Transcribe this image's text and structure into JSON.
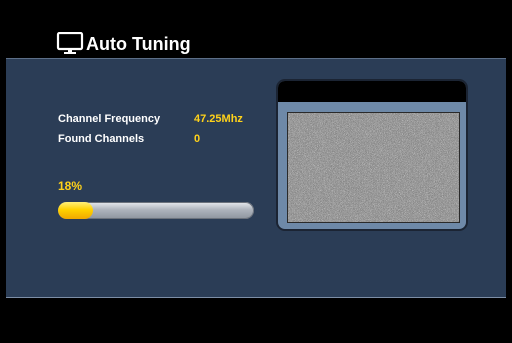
{
  "header": {
    "title": "Auto Tuning",
    "icon": "tv-icon"
  },
  "scan_info": {
    "frequency_label": "Channel Frequency",
    "frequency_value": "47.25Mhz",
    "found_label": "Found Channels",
    "found_value": "0"
  },
  "progress": {
    "text": "18%",
    "percent": 18
  },
  "preview": {
    "state": "static-noise"
  },
  "colors": {
    "background": "#000000",
    "panel": "#2b3d56",
    "label_text": "#ffffff",
    "value_text": "#ffd21a",
    "progress_fill": "#ffd200",
    "progress_track": "#aeb4bd",
    "tv_frame": "#6e89a8"
  }
}
